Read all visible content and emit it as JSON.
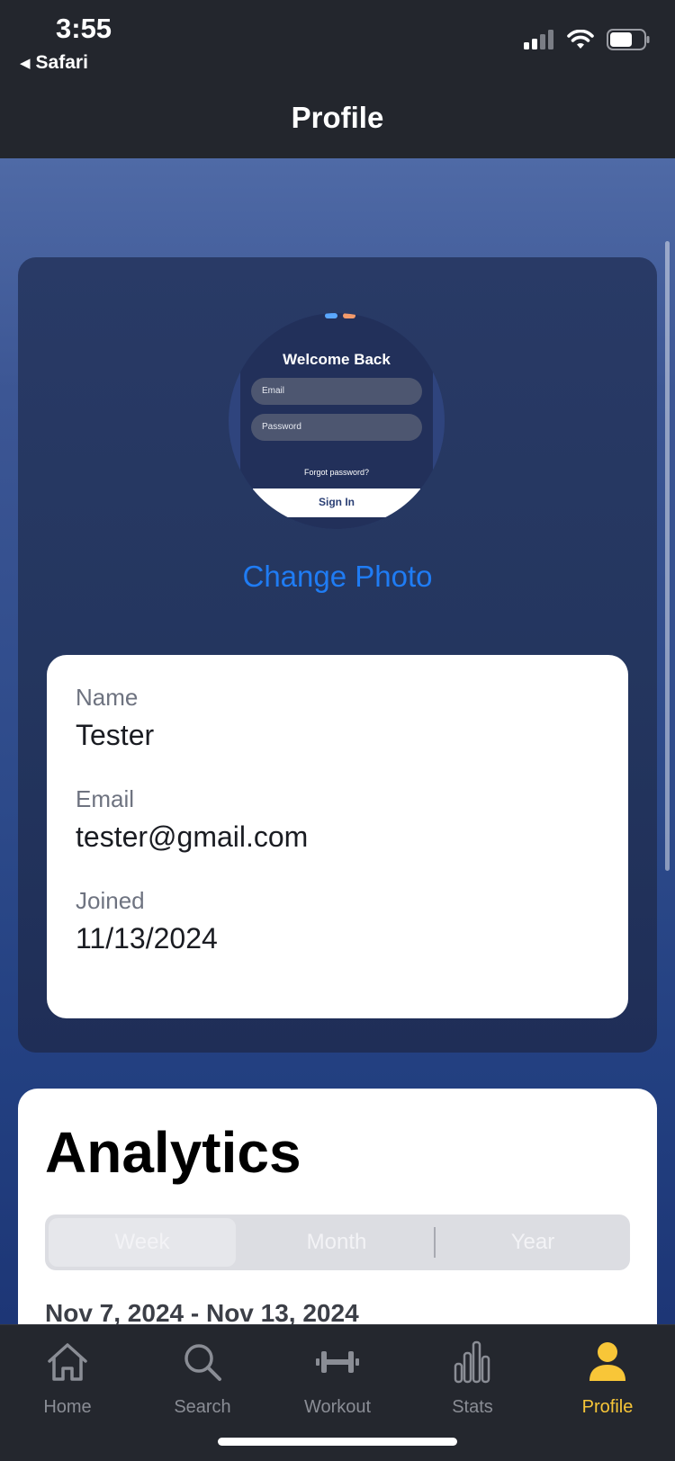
{
  "status_bar": {
    "time": "3:55",
    "back_app": "Safari"
  },
  "nav": {
    "title": "Profile"
  },
  "profile": {
    "avatar_preview": {
      "welcome": "Welcome Back",
      "email_placeholder": "Email",
      "password_placeholder": "Password",
      "forgot": "Forgot password?",
      "sign_in": "Sign In"
    },
    "change_photo_label": "Change Photo",
    "fields": [
      {
        "label": "Name",
        "value": "Tester"
      },
      {
        "label": "Email",
        "value": "tester@gmail.com"
      },
      {
        "label": "Joined",
        "value": "11/13/2024"
      }
    ]
  },
  "analytics": {
    "title": "Analytics",
    "segments": [
      "Week",
      "Month",
      "Year"
    ],
    "selected_segment": "Week",
    "date_range": "Nov 7, 2024 - Nov 13, 2024"
  },
  "tabbar": {
    "items": [
      {
        "label": "Home",
        "icon": "house-icon"
      },
      {
        "label": "Search",
        "icon": "magnifier-icon"
      },
      {
        "label": "Workout",
        "icon": "dumbbell-icon"
      },
      {
        "label": "Stats",
        "icon": "bar-chart-icon"
      },
      {
        "label": "Profile",
        "icon": "person-icon"
      }
    ],
    "active": "Profile",
    "active_color": "#f8c638",
    "inactive_color": "#8a8d95"
  },
  "colors": {
    "accent_link": "#1f7cf4",
    "header_bg": "#23262d"
  }
}
